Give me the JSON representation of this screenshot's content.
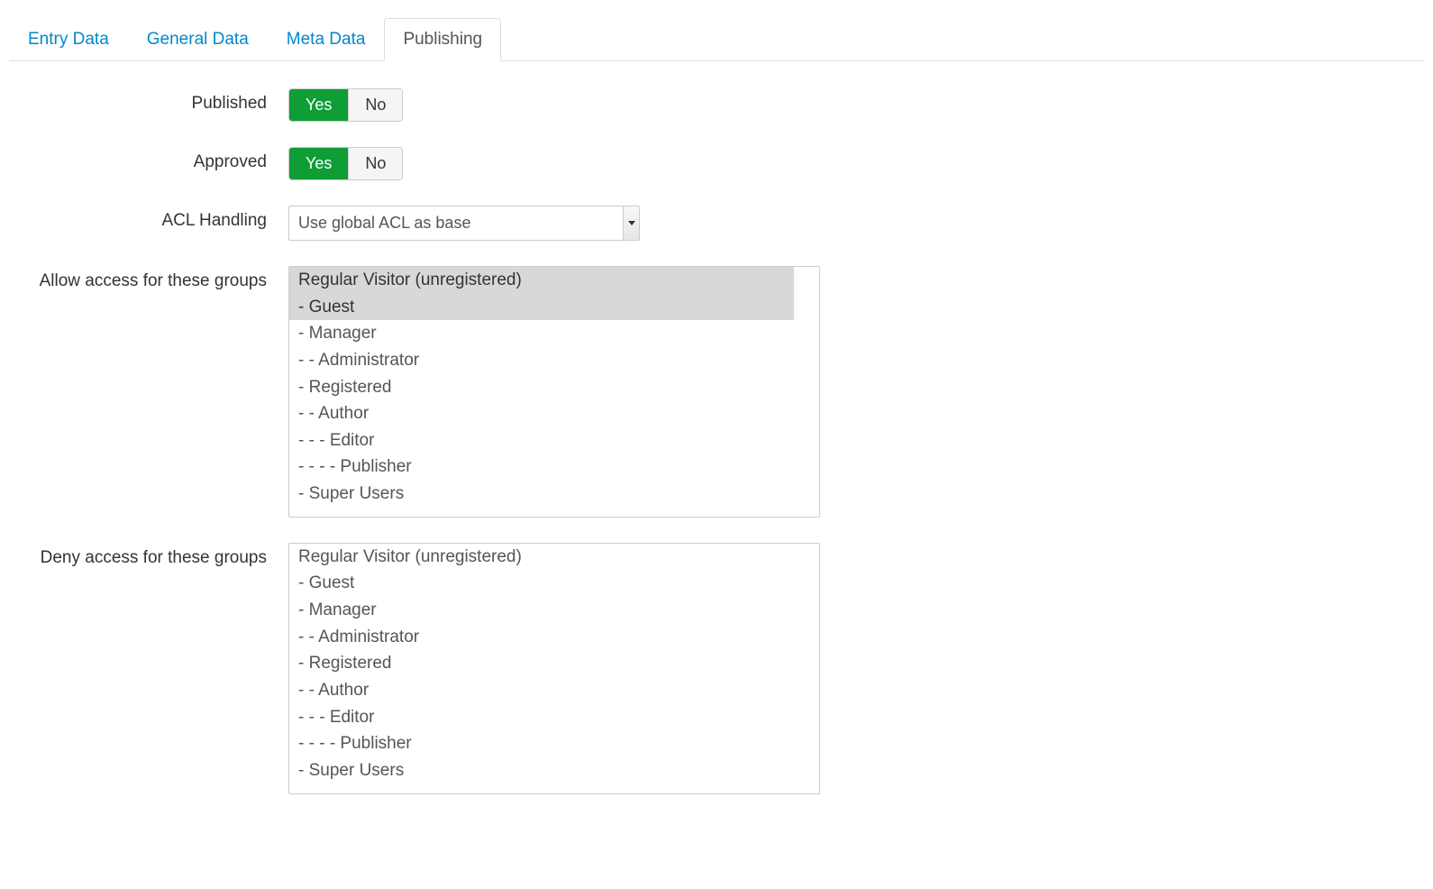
{
  "tabs": {
    "entry_data": "Entry Data",
    "general_data": "General Data",
    "meta_data": "Meta Data",
    "publishing": "Publishing"
  },
  "form": {
    "published": {
      "label": "Published",
      "yes": "Yes",
      "no": "No",
      "value": "yes"
    },
    "approved": {
      "label": "Approved",
      "yes": "Yes",
      "no": "No",
      "value": "yes"
    },
    "acl_handling": {
      "label": "ACL Handling",
      "selected": "Use global ACL as base"
    },
    "allow_groups": {
      "label": "Allow access for these groups",
      "options": [
        {
          "text": "Regular Visitor (unregistered)",
          "selected": true
        },
        {
          "text": "- Guest",
          "selected": true
        },
        {
          "text": "- Manager",
          "selected": false
        },
        {
          "text": "- - Administrator",
          "selected": false
        },
        {
          "text": "- Registered",
          "selected": false
        },
        {
          "text": "- - Author",
          "selected": false
        },
        {
          "text": "- - - Editor",
          "selected": false
        },
        {
          "text": "- - - - Publisher",
          "selected": false
        },
        {
          "text": "- Super Users",
          "selected": false
        }
      ]
    },
    "deny_groups": {
      "label": "Deny access for these groups",
      "options": [
        {
          "text": "Regular Visitor (unregistered)",
          "selected": false
        },
        {
          "text": "- Guest",
          "selected": false
        },
        {
          "text": "- Manager",
          "selected": false
        },
        {
          "text": "- - Administrator",
          "selected": false
        },
        {
          "text": "- Registered",
          "selected": false
        },
        {
          "text": "- - Author",
          "selected": false
        },
        {
          "text": "- - - Editor",
          "selected": false
        },
        {
          "text": "- - - - Publisher",
          "selected": false
        },
        {
          "text": "- Super Users",
          "selected": false
        }
      ]
    }
  }
}
